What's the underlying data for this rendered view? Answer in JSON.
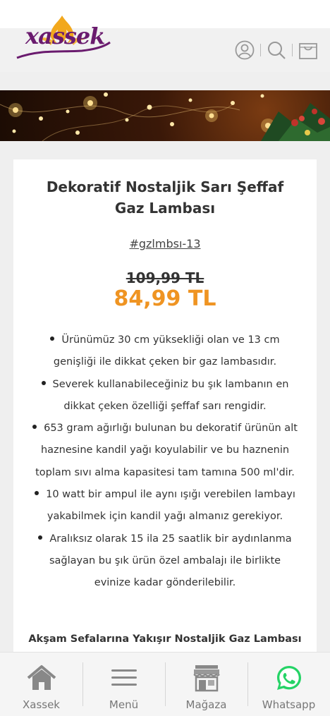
{
  "header": {
    "logo_text": "xassek",
    "icons": [
      "user-icon",
      "search-icon",
      "cart-icon"
    ]
  },
  "product": {
    "title": "Dekoratif Nostaljik Sarı Şeffaf Gaz Lambası",
    "sku": "#gzlmbsı-13",
    "old_price": "109,99 TL",
    "new_price": "84,99 TL",
    "features": [
      "Ürünümüz 30 cm yüksekliği olan ve 13 cm genişliği ile dikkat çeken bir gaz lambasıdır.",
      "Severek kullanabileceğiniz bu şık lambanın en dikkat çeken özelliği şeffaf sarı rengidir.",
      "653 gram ağırlığı bulunan bu dekoratif ürünün alt haznesine kandil yağı koyulabilir ve bu haznenin toplam sıvı alma kapasitesi tam tamına 500 ml'dir.",
      "10 watt bir ampul ile aynı ışığı verebilen lambayı yakabilmek için kandil yağı almanız gerekiyor.",
      "Aralıksız olarak 15 ila 25 saatlik bir aydınlanma sağlayan bu şık ürün özel ambalajı ile birlikte evinize kadar gönderilebilir."
    ],
    "subheading": "Akşam Sefalarına Yakışır Nostaljik Gaz Lambası"
  },
  "bottom_nav": {
    "items": [
      {
        "label": "Xassek",
        "icon": "home-icon"
      },
      {
        "label": "Menü",
        "icon": "menu-icon"
      },
      {
        "label": "Mağaza",
        "icon": "store-icon"
      },
      {
        "label": "Whatsapp",
        "icon": "whatsapp-icon"
      }
    ]
  },
  "colors": {
    "accent_price": "#ef9422",
    "logo_purple": "#6a1b6e",
    "logo_orange": "#f2a81d",
    "whatsapp_green": "#25d366"
  }
}
